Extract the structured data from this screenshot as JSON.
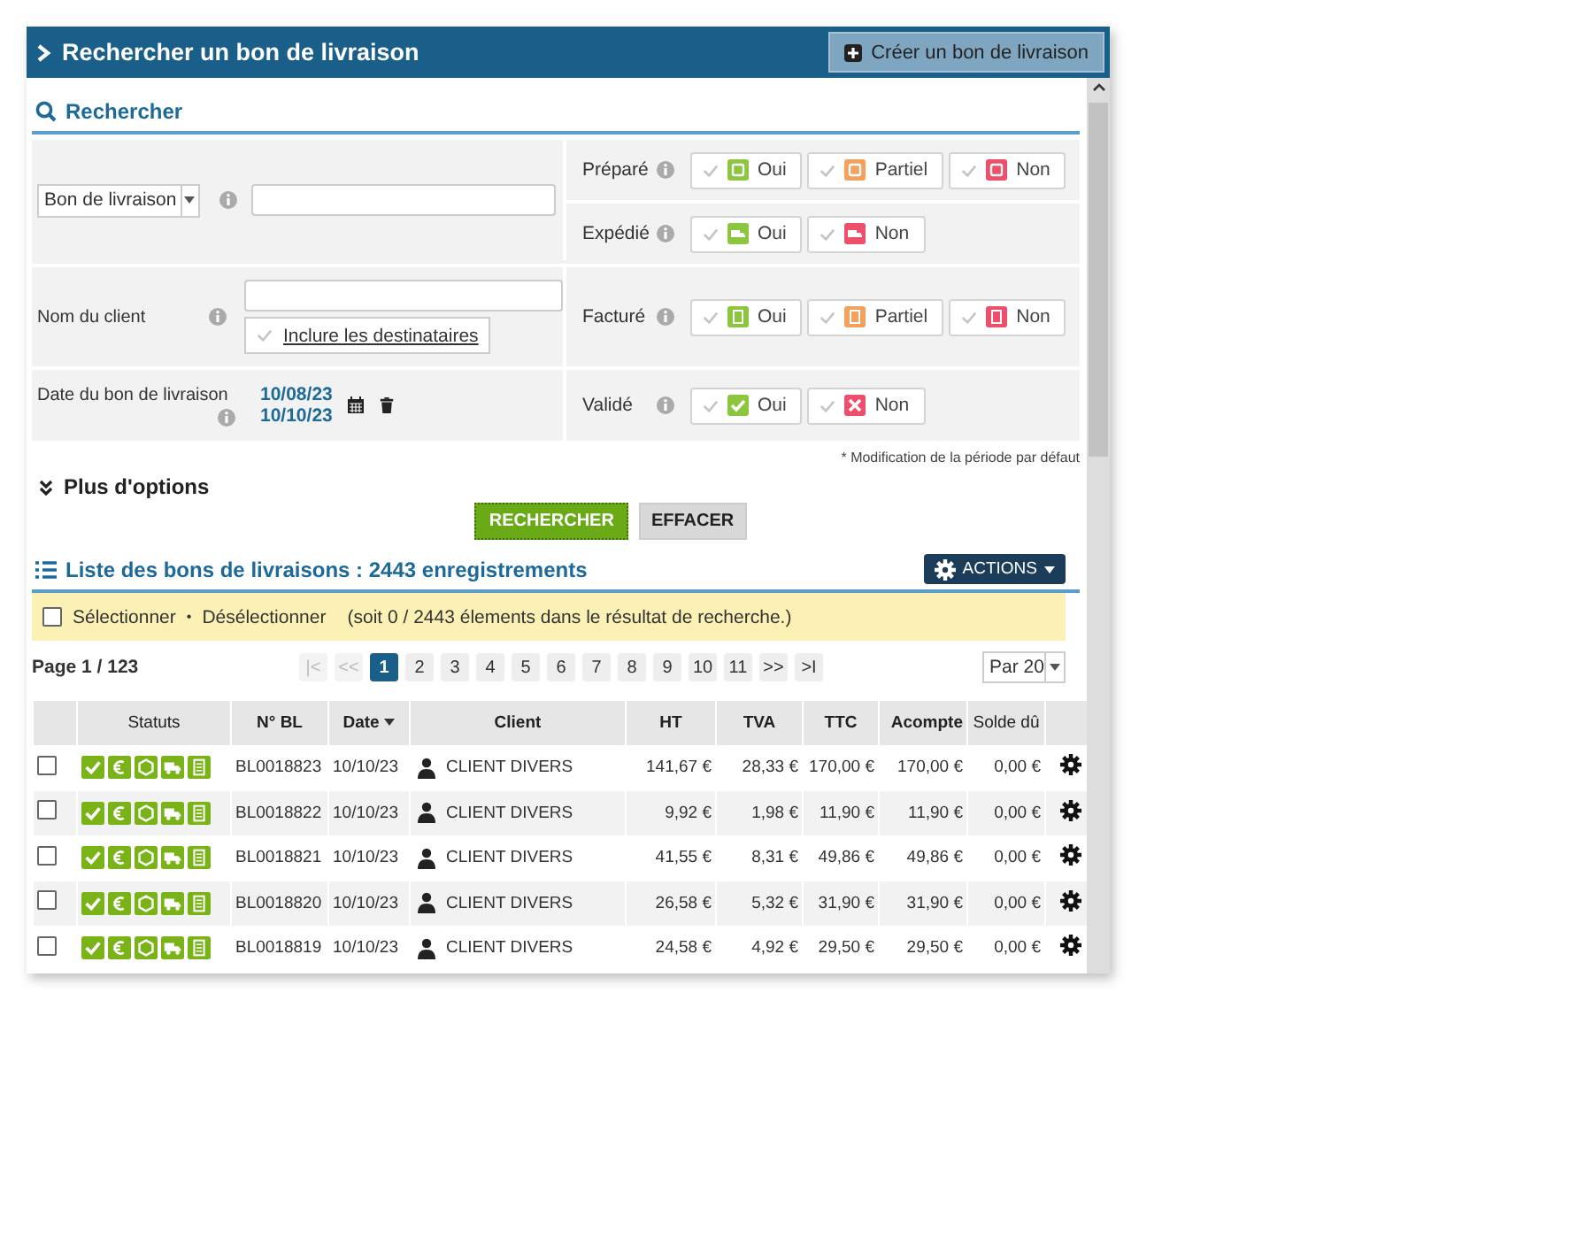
{
  "header": {
    "title": "Rechercher un bon de livraison",
    "create_button": "Créer un bon de livraison"
  },
  "search": {
    "title": "Rechercher",
    "doc_type": "Bon de livraison",
    "client": {
      "label": "Nom du client",
      "include_button": "Inclure les destinataires",
      "include_checked": false
    },
    "date": {
      "label": "Date du bon de livraison",
      "from": "10/08/23",
      "to": "10/10/23"
    },
    "filters": [
      {
        "label": "Préparé",
        "kind": "box",
        "options": [
          {
            "label": "Oui",
            "kind": "yes",
            "checked": false
          },
          {
            "label": "Partiel",
            "kind": "partial",
            "checked": false
          },
          {
            "label": "Non",
            "kind": "no",
            "checked": false
          }
        ]
      },
      {
        "label": "Expédié",
        "kind": "truck",
        "options": [
          {
            "label": "Oui",
            "kind": "yes",
            "checked": false
          },
          {
            "label": "Non",
            "kind": "no",
            "checked": false
          }
        ]
      },
      {
        "label": "Facturé",
        "kind": "doc",
        "options": [
          {
            "label": "Oui",
            "kind": "yes",
            "checked": false
          },
          {
            "label": "Partiel",
            "kind": "partial",
            "checked": false
          },
          {
            "label": "Non",
            "kind": "no",
            "checked": false
          }
        ]
      },
      {
        "label": "Validé",
        "kind": "check",
        "options": [
          {
            "label": "Oui",
            "kind": "yes",
            "checked": false
          },
          {
            "label": "Non",
            "kind": "no",
            "checked": false
          }
        ]
      }
    ],
    "note": "* Modification de la période par défaut",
    "more_options": "Plus d'options",
    "search_button": "RECHERCHER",
    "clear_button": "EFFACER"
  },
  "list": {
    "title": "Liste des bons de livraisons : 2443 enregistrements",
    "actions_button": "ACTIONS",
    "select_all": "Sélectionner",
    "select_all_checked": false,
    "separator": "•",
    "deselect": "Désélectionner",
    "selection_info": "(soit 0 / 2443 élements dans le résultat de recherche.)",
    "page_info": "Page 1 / 123",
    "pages": [
      {
        "label": "|<",
        "disabled": true,
        "selected": false
      },
      {
        "label": "<<",
        "disabled": true,
        "selected": false
      },
      {
        "label": "1",
        "disabled": false,
        "selected": true
      },
      {
        "label": "2",
        "disabled": false,
        "selected": false
      },
      {
        "label": "3",
        "disabled": false,
        "selected": false
      },
      {
        "label": "4",
        "disabled": false,
        "selected": false
      },
      {
        "label": "5",
        "disabled": false,
        "selected": false
      },
      {
        "label": "6",
        "disabled": false,
        "selected": false
      },
      {
        "label": "7",
        "disabled": false,
        "selected": false
      },
      {
        "label": "8",
        "disabled": false,
        "selected": false
      },
      {
        "label": "9",
        "disabled": false,
        "selected": false
      },
      {
        "label": "10",
        "disabled": false,
        "selected": false
      },
      {
        "label": "11",
        "disabled": false,
        "selected": false
      },
      {
        "label": ">>",
        "disabled": false,
        "selected": false
      },
      {
        "label": ">I",
        "disabled": false,
        "selected": false
      }
    ],
    "per_page": "Par 20",
    "columns": [
      {
        "label": "Statuts",
        "sorted": false
      },
      {
        "label": "N° BL",
        "sorted": false
      },
      {
        "label": "Date",
        "sorted": true
      },
      {
        "label": "Client",
        "sorted": false
      },
      {
        "label": "HT",
        "sorted": false
      },
      {
        "label": "TVA",
        "sorted": false
      },
      {
        "label": "TTC",
        "sorted": false
      },
      {
        "label": "Acompte",
        "sorted": false
      },
      {
        "label": "Solde dû",
        "sorted": false
      }
    ],
    "rows": [
      {
        "checked": false,
        "number": "BL0018823",
        "date": "10/10/23",
        "client": "CLIENT DIVERS",
        "ht": "141,67 €",
        "tva": "28,33 €",
        "ttc": "170,00 €",
        "acompte": "170,00 €",
        "solde": "0,00 €"
      },
      {
        "checked": false,
        "number": "BL0018822",
        "date": "10/10/23",
        "client": "CLIENT DIVERS",
        "ht": "9,92 €",
        "tva": "1,98 €",
        "ttc": "11,90 €",
        "acompte": "11,90 €",
        "solde": "0,00 €"
      },
      {
        "checked": false,
        "number": "BL0018821",
        "date": "10/10/23",
        "client": "CLIENT DIVERS",
        "ht": "41,55 €",
        "tva": "8,31 €",
        "ttc": "49,86 €",
        "acompte": "49,86 €",
        "solde": "0,00 €"
      },
      {
        "checked": false,
        "number": "BL0018820",
        "date": "10/10/23",
        "client": "CLIENT DIVERS",
        "ht": "26,58 €",
        "tva": "5,32 €",
        "ttc": "31,90 €",
        "acompte": "31,90 €",
        "solde": "0,00 €"
      },
      {
        "checked": false,
        "number": "BL0018819",
        "date": "10/10/23",
        "client": "CLIENT DIVERS",
        "ht": "24,58 €",
        "tva": "4,92 €",
        "ttc": "29,50 €",
        "acompte": "29,50 €",
        "solde": "0,00 €"
      }
    ]
  }
}
